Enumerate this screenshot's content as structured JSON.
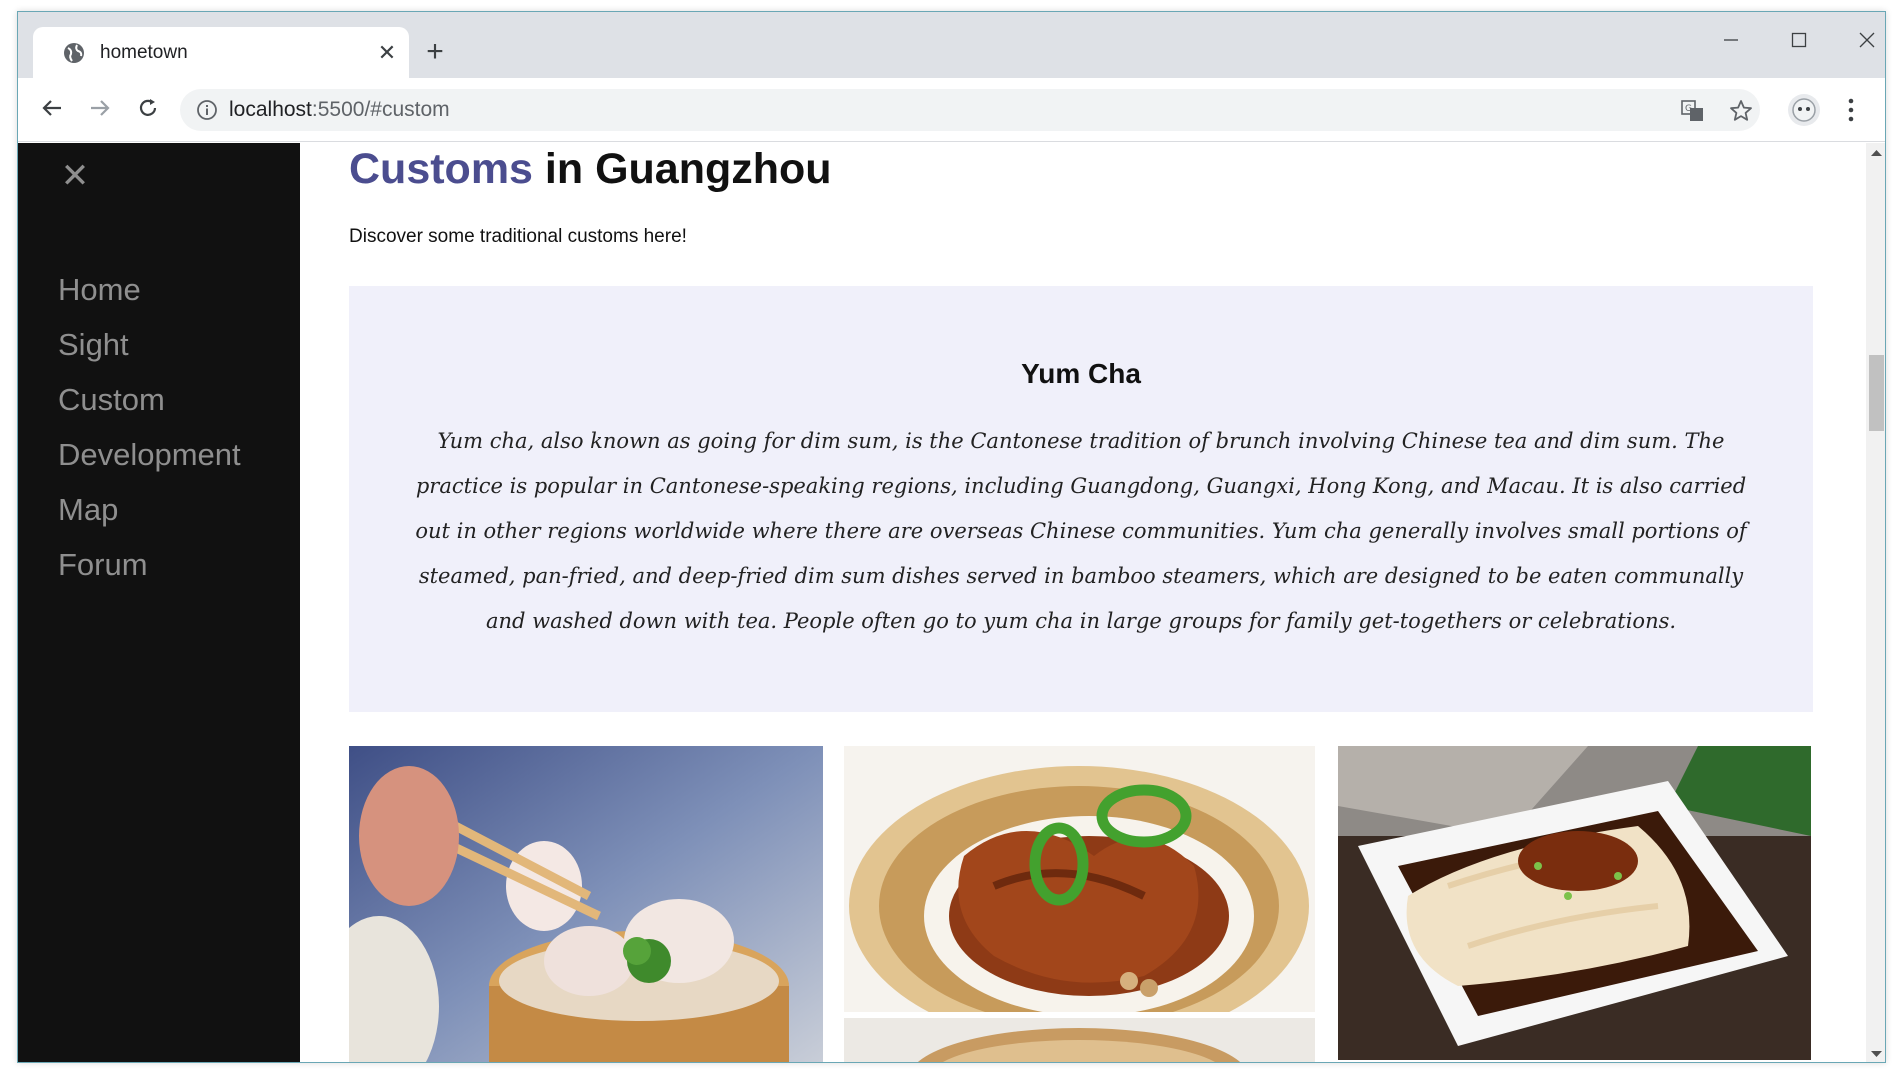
{
  "browser": {
    "tab_title": "hometown",
    "url_host": "localhost",
    "url_rest": ":5500/#custom",
    "new_tab_label": "+",
    "tab_close_label": "✕",
    "icons": [
      "globe-icon",
      "info-icon",
      "translate-icon",
      "star-icon",
      "profile-icon",
      "menu-icon"
    ]
  },
  "sidebar": {
    "close_label": "✕",
    "items": [
      {
        "label": "Home"
      },
      {
        "label": "Sight"
      },
      {
        "label": "Custom"
      },
      {
        "label": "Development"
      },
      {
        "label": "Map"
      },
      {
        "label": "Forum"
      }
    ]
  },
  "main": {
    "title_accent": "Customs",
    "title_rest": " in Guangzhou",
    "intro": "Discover some traditional customs here!",
    "card": {
      "title": "Yum Cha",
      "body": "Yum cha, also known as going for dim sum, is the Cantonese tradition of brunch involving Chinese tea and dim sum. The practice is popular in Cantonese-speaking regions, including Guangdong, Guangxi, Hong Kong, and Macau. It is also carried out in other regions worldwide where there are overseas Chinese communities. Yum cha generally involves small portions of steamed, pan-fried, and deep-fried dim sum dishes served in bamboo steamers, which are designed to be eaten communally and washed down with tea. People often go to yum cha in large groups for family get-togethers or celebrations."
    }
  },
  "colors": {
    "accent": "#4b4d8f",
    "sidebar_bg": "#111111",
    "sidebar_text": "#8f8f8f",
    "card_bg": "#f0f0fa"
  }
}
